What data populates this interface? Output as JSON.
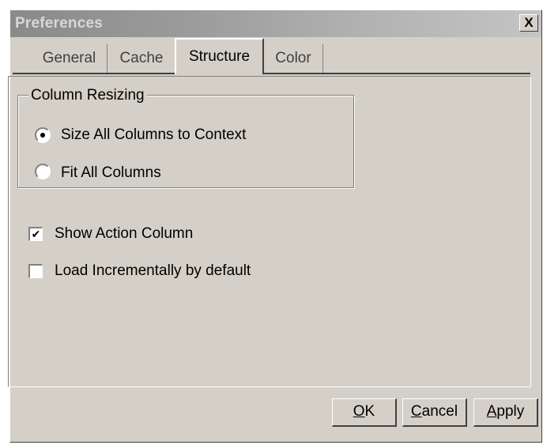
{
  "window": {
    "title": "Preferences",
    "close_label": "X"
  },
  "tabs": [
    {
      "label": "General",
      "selected": false
    },
    {
      "label": "Cache",
      "selected": false
    },
    {
      "label": "Structure",
      "selected": true
    },
    {
      "label": "Color",
      "selected": false
    }
  ],
  "column_resizing": {
    "group_label": "Column Resizing",
    "options": [
      {
        "label": "Size All Columns to Context",
        "selected": true
      },
      {
        "label": "Fit All Columns",
        "selected": false
      }
    ]
  },
  "checkboxes": [
    {
      "label": "Show Action Column",
      "checked": true
    },
    {
      "label": "Load Incrementally by default",
      "checked": false
    }
  ],
  "buttons": {
    "ok": {
      "mnemonic": "O",
      "rest": "K"
    },
    "cancel": {
      "mnemonic": "C",
      "rest": "ancel"
    },
    "apply": {
      "mnemonic": "A",
      "rest": "pply"
    }
  }
}
